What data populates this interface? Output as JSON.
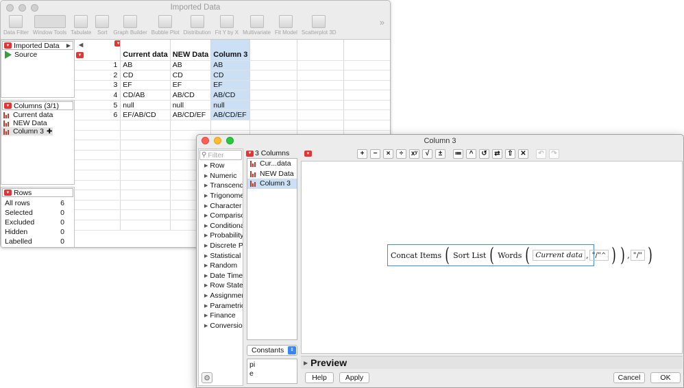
{
  "main_window": {
    "title": "Imported Data",
    "toolbar": [
      "Data Filter",
      "Window Tools",
      "Tabulate",
      "Sort",
      "Graph Builder",
      "Bubble Plot",
      "Distribution",
      "Fit Y by X",
      "Multivariate",
      "Fit Model",
      "Scatterplot 3D"
    ],
    "table_panel": {
      "title": "Imported Data",
      "items": [
        "Source"
      ]
    },
    "columns_panel": {
      "title": "Columns (3/1)",
      "items": [
        "Current data",
        "NEW Data",
        "Column 3"
      ],
      "plus": "✚"
    },
    "rows_panel": {
      "title": "Rows",
      "stats": [
        {
          "label": "All rows",
          "value": "6"
        },
        {
          "label": "Selected",
          "value": "0"
        },
        {
          "label": "Excluded",
          "value": "0"
        },
        {
          "label": "Hidden",
          "value": "0"
        },
        {
          "label": "Labelled",
          "value": "0"
        }
      ]
    },
    "grid": {
      "headers": [
        "Current data",
        "NEW Data",
        "Column 3"
      ],
      "rows": [
        [
          "1",
          "AB",
          "AB",
          "AB"
        ],
        [
          "2",
          "CD",
          "CD",
          "CD"
        ],
        [
          "3",
          "EF",
          "EF",
          "EF"
        ],
        [
          "4",
          "CD/AB",
          "AB/CD",
          "AB/CD"
        ],
        [
          "5",
          "null",
          "null",
          "null"
        ],
        [
          "6",
          "EF/AB/CD",
          "AB/CD/EF",
          "AB/CD/EF"
        ]
      ]
    }
  },
  "formula_window": {
    "title": "Column 3",
    "filter_placeholder": "Filter",
    "functions": [
      "Row",
      "Numeric",
      "Transcend",
      "Trigonome",
      "Character",
      "Compariso",
      "Conditiona",
      "Probability",
      "Discrete Pr",
      "Statistical",
      "Random",
      "Date Time",
      "Row State",
      "Assignmen",
      "Parametric",
      "Finance",
      "Conversion"
    ],
    "columns_title": "3 Columns",
    "columns": [
      "Cur...data",
      "NEW Data",
      "Column 3"
    ],
    "constants_select": "Constants",
    "constants": [
      "pi",
      "e"
    ],
    "formula": {
      "outer": "Concat Items",
      "sort": "Sort List",
      "words": "Words",
      "arg_column": "Current data",
      "delim1": "\"/\"",
      "delim2": "\"/\""
    },
    "preview_label": "Preview",
    "buttons": {
      "help": "Help",
      "apply": "Apply",
      "cancel": "Cancel",
      "ok": "OK"
    }
  }
}
